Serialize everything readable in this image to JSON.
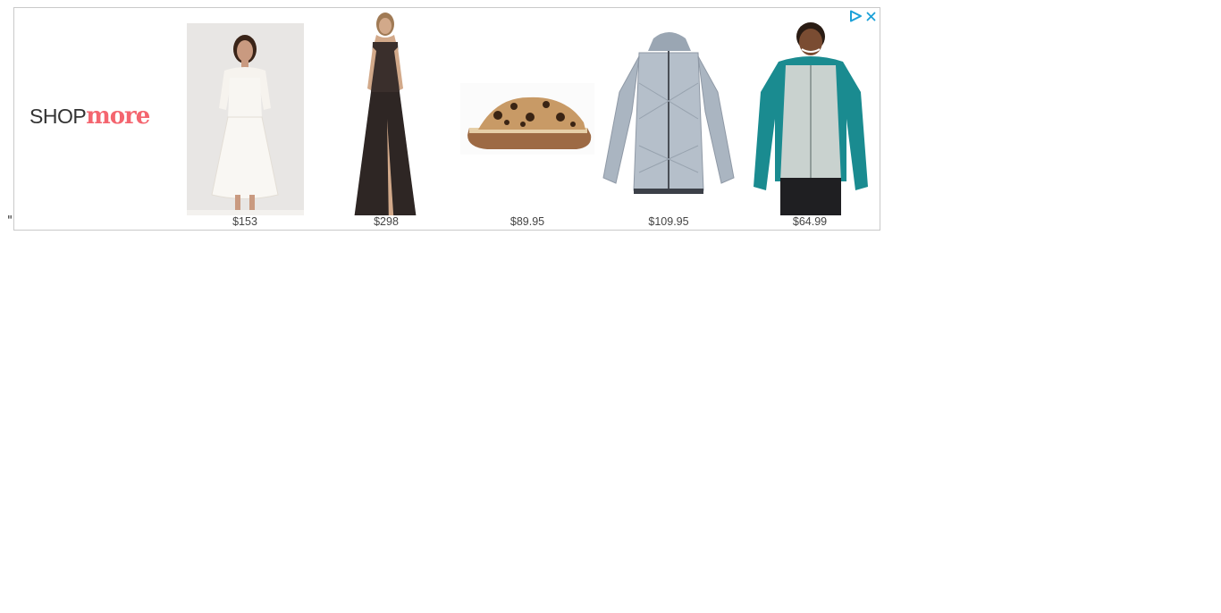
{
  "stray_text": "\"",
  "ad": {
    "brand": {
      "part1": "SHOP",
      "part2": "more"
    },
    "colors": {
      "brand_accent": "#f4656f",
      "adchoices": "#1aa0d8",
      "border": "#c9c9c9",
      "price_text": "#444444"
    },
    "icons": [
      "adchoices-icon",
      "close-icon"
    ],
    "products": [
      {
        "name": "white-lace-dress",
        "price": "$153"
      },
      {
        "name": "black-lace-gown",
        "price": "$298"
      },
      {
        "name": "leopard-fur-slide-sandal",
        "price": "$89.95"
      },
      {
        "name": "grey-quilted-puffer-jacket",
        "price": "$109.95"
      },
      {
        "name": "teal-grey-colorblock-jacket",
        "price": "$64.99"
      }
    ]
  }
}
